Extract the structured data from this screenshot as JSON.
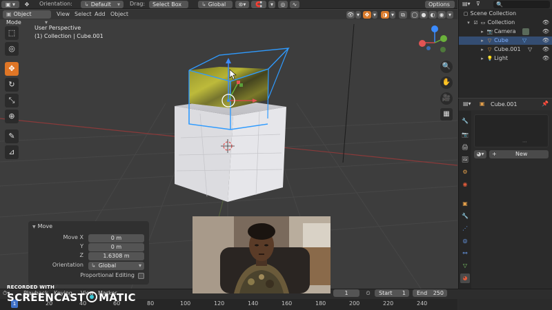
{
  "header": {
    "orientation_label": "Orientation:",
    "orientation_value": "Default",
    "drag_label": "Drag:",
    "drag_value": "Select Box",
    "transform_value": "Global",
    "options_label": "Options"
  },
  "modebar": {
    "mode": "Object Mode",
    "menus": [
      "View",
      "Select",
      "Add",
      "Object"
    ]
  },
  "viewport": {
    "perspective": "User Perspective",
    "collection_info": "(1) Collection | Cube.001"
  },
  "tools": [
    {
      "icon": "select-box-icon",
      "glyph": "▣"
    },
    {
      "icon": "cursor-icon",
      "glyph": "◎"
    },
    {
      "icon": "move-icon",
      "glyph": "✥",
      "active": true
    },
    {
      "icon": "rotate-icon",
      "glyph": "↻"
    },
    {
      "icon": "scale-icon",
      "glyph": "⤢"
    },
    {
      "icon": "transform-icon",
      "glyph": "⊕"
    },
    {
      "icon": "annotate-icon",
      "glyph": "✎"
    },
    {
      "icon": "measure-icon",
      "glyph": "📐"
    }
  ],
  "move_panel": {
    "title": "Move",
    "move_x_label": "Move X",
    "move_x": "0 m",
    "y_label": "Y",
    "y": "0 m",
    "z_label": "Z",
    "z": "1.6308 m",
    "orientation_label": "Orientation",
    "orientation_value": "Global",
    "proportional_label": "Proportional Editing"
  },
  "outliner": {
    "title": "Scene Collection",
    "items": [
      {
        "label": "Collection",
        "icon": "collection-icon"
      },
      {
        "label": "Camera",
        "icon": "camera-icon"
      },
      {
        "label": "Cube",
        "icon": "mesh-icon"
      },
      {
        "label": "Cube.001",
        "icon": "mesh-icon"
      },
      {
        "label": "Light",
        "icon": "light-icon"
      }
    ]
  },
  "properties": {
    "object_name": "Cube.001",
    "new_button": "New",
    "add_symbol": "+"
  },
  "timeline": {
    "menus": [
      "Playback",
      "Keying",
      "View",
      "Marker"
    ],
    "current_frame": "1",
    "start_label": "Start",
    "start": "1",
    "end_label": "End",
    "end": "250",
    "ticks": [
      "20",
      "40",
      "60",
      "80",
      "100",
      "120",
      "140",
      "160",
      "180",
      "200",
      "220",
      "240"
    ],
    "playhead": "1"
  },
  "watermark": {
    "line1": "RECORDED WITH",
    "line2a": "SCREENCAST",
    "line2b": "MATIC"
  },
  "colors": {
    "accent": "#e07626",
    "selection": "#344d72",
    "selection_text": "#7fb0ff",
    "outline": "#2f9bff"
  }
}
